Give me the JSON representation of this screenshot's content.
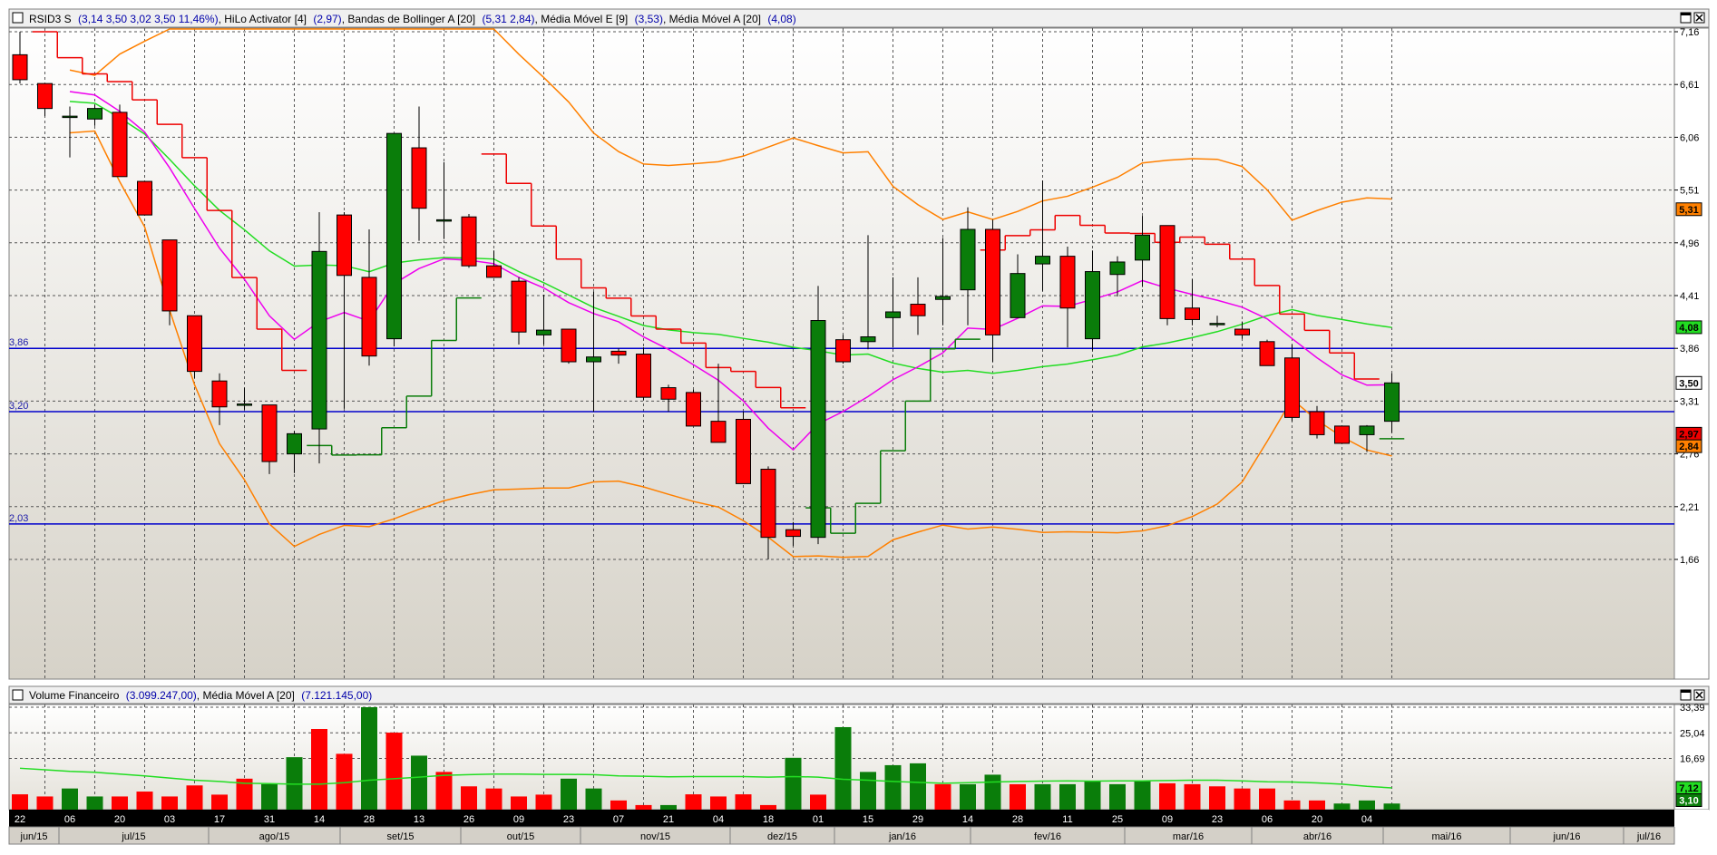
{
  "price_panel": {
    "symbol": "RSID3 S",
    "ohlc_text": "(3,14  3,50  3,02  3,50  11,46%)",
    "ind1_name": "HiLo Activator [4]",
    "ind1_value": "(2,97)",
    "ind2_name": "Bandas de Bollinger A [20]",
    "ind2_value": "(5,31  2,84)",
    "ind3_name": "Média Móvel E [9]",
    "ind3_value": "(3,53)",
    "ind4_name": "Média Móvel A [20]",
    "ind4_value": "(4,08)",
    "sep": ", "
  },
  "volume_panel": {
    "name": "Volume Financeiro",
    "value": "(3.099.247,00)",
    "ma_name": "Média Móvel A [20]",
    "ma_value": "(7.121.145,00)"
  },
  "colors": {
    "up": "#0a7d0a",
    "down": "#ff0000",
    "hilo": "#ee0000",
    "bollinger": "#ff8000",
    "ema9": "#ee00ee",
    "sma20": "#22dd22",
    "level_line": "#0000cc",
    "vol_ma": "#22dd22"
  },
  "chart_data": [
    {
      "type": "candlestick",
      "title": "RSID3 S",
      "ylim": [
        1.66,
        7.16
      ],
      "yticks": [
        "7,16",
        "6,61",
        "6,06",
        "5,51",
        "4,96",
        "4,41",
        "3,86",
        "3,31",
        "2,76",
        "2,21",
        "1,66"
      ],
      "ytick_values": [
        7.16,
        6.61,
        6.06,
        5.51,
        4.96,
        4.41,
        3.86,
        3.31,
        2.76,
        2.21,
        1.66
      ],
      "date_labels": [
        "22",
        "06",
        "20",
        "03",
        "17",
        "31",
        "14",
        "28",
        "13",
        "26",
        "09",
        "23",
        "07",
        "21",
        "04",
        "18",
        "01",
        "15",
        "29",
        "14",
        "28",
        "11",
        "25",
        "09",
        "23",
        "06",
        "20",
        "04"
      ],
      "month_labels": [
        "jun/15",
        "jul/15",
        "ago/15",
        "set/15",
        "out/15",
        "nov/15",
        "dez/15",
        "jan/16",
        "fev/16",
        "mar/16",
        "abr/16",
        "mai/16",
        "jun/16",
        "jul/16"
      ],
      "horizontal_levels": [
        {
          "label": "3,86",
          "value": 3.86
        },
        {
          "label": "3,20",
          "value": 3.2
        },
        {
          "label": "2,03",
          "value": 2.03
        }
      ],
      "last_value_tags": [
        {
          "label": "5,31",
          "value": 5.31,
          "color": "#ff8000",
          "text_color": "#000000"
        },
        {
          "label": "4,08",
          "value": 4.08,
          "color": "#22dd22",
          "text_color": "#000000"
        },
        {
          "label": "3,50",
          "value": 3.5,
          "color": "#ffffff",
          "text_color": "#000000"
        },
        {
          "label": "2,97",
          "value": 2.97,
          "color": "#ee0000",
          "text_color": "#000000"
        },
        {
          "label": "2,84",
          "value": 2.84,
          "color": "#ff8000",
          "text_color": "#000000"
        }
      ],
      "candles": [
        {
          "o": 6.92,
          "h": 7.16,
          "l": 6.62,
          "c": 6.66
        },
        {
          "o": 6.62,
          "h": 6.62,
          "l": 6.28,
          "c": 6.36
        },
        {
          "o": 6.28,
          "h": 6.38,
          "l": 5.85,
          "c": 6.28
        },
        {
          "o": 6.25,
          "h": 6.4,
          "l": 6.18,
          "c": 6.36
        },
        {
          "o": 6.32,
          "h": 6.4,
          "l": 5.65,
          "c": 5.65
        },
        {
          "o": 5.6,
          "h": 5.6,
          "l": 5.25,
          "c": 5.25
        },
        {
          "o": 4.99,
          "h": 4.99,
          "l": 4.1,
          "c": 4.25
        },
        {
          "o": 4.2,
          "h": 4.2,
          "l": 3.55,
          "c": 3.62
        },
        {
          "o": 3.52,
          "h": 3.6,
          "l": 3.06,
          "c": 3.25
        },
        {
          "o": 3.28,
          "h": 3.45,
          "l": 3.22,
          "c": 3.28
        },
        {
          "o": 3.27,
          "h": 3.27,
          "l": 2.55,
          "c": 2.68
        },
        {
          "o": 2.76,
          "h": 3.0,
          "l": 2.56,
          "c": 2.97
        },
        {
          "o": 3.02,
          "h": 5.28,
          "l": 2.66,
          "c": 4.87
        },
        {
          "o": 5.25,
          "h": 5.28,
          "l": 3.23,
          "c": 4.62
        },
        {
          "o": 4.6,
          "h": 5.1,
          "l": 3.68,
          "c": 3.78
        },
        {
          "o": 3.96,
          "h": 6.1,
          "l": 3.88,
          "c": 6.1
        },
        {
          "o": 5.95,
          "h": 6.38,
          "l": 4.98,
          "c": 5.32
        },
        {
          "o": 5.2,
          "h": 5.8,
          "l": 5.0,
          "c": 5.2
        },
        {
          "o": 5.23,
          "h": 5.26,
          "l": 4.7,
          "c": 4.72
        },
        {
          "o": 4.72,
          "h": 4.88,
          "l": 4.6,
          "c": 4.6
        },
        {
          "o": 4.56,
          "h": 4.6,
          "l": 3.9,
          "c": 4.03
        },
        {
          "o": 4.0,
          "h": 4.42,
          "l": 3.9,
          "c": 4.05
        },
        {
          "o": 4.06,
          "h": 4.06,
          "l": 3.7,
          "c": 3.72
        },
        {
          "o": 3.72,
          "h": 4.45,
          "l": 3.2,
          "c": 3.77
        },
        {
          "o": 3.83,
          "h": 3.86,
          "l": 3.7,
          "c": 3.79
        },
        {
          "o": 3.8,
          "h": 3.87,
          "l": 3.32,
          "c": 3.35
        },
        {
          "o": 3.45,
          "h": 3.48,
          "l": 3.2,
          "c": 3.33
        },
        {
          "o": 3.4,
          "h": 3.43,
          "l": 3.05,
          "c": 3.05
        },
        {
          "o": 3.1,
          "h": 3.7,
          "l": 2.88,
          "c": 2.88
        },
        {
          "o": 3.12,
          "h": 3.2,
          "l": 2.45,
          "c": 2.45
        },
        {
          "o": 2.6,
          "h": 2.63,
          "l": 1.66,
          "c": 1.89
        },
        {
          "o": 1.97,
          "h": 2.05,
          "l": 1.8,
          "c": 1.9
        },
        {
          "o": 1.89,
          "h": 4.51,
          "l": 1.82,
          "c": 4.15
        },
        {
          "o": 3.95,
          "h": 4.0,
          "l": 3.7,
          "c": 3.72
        },
        {
          "o": 3.93,
          "h": 5.04,
          "l": 3.85,
          "c": 3.98
        },
        {
          "o": 4.18,
          "h": 4.6,
          "l": 3.87,
          "c": 4.24
        },
        {
          "o": 4.32,
          "h": 4.6,
          "l": 4.0,
          "c": 4.2
        },
        {
          "o": 4.37,
          "h": 5.01,
          "l": 4.1,
          "c": 4.4
        },
        {
          "o": 4.47,
          "h": 5.33,
          "l": 4.1,
          "c": 5.1
        },
        {
          "o": 5.1,
          "h": 5.2,
          "l": 3.72,
          "c": 4.0
        },
        {
          "o": 4.18,
          "h": 4.84,
          "l": 4.18,
          "c": 4.64
        },
        {
          "o": 4.74,
          "h": 5.61,
          "l": 4.46,
          "c": 4.82
        },
        {
          "o": 4.82,
          "h": 4.92,
          "l": 3.87,
          "c": 4.28
        },
        {
          "o": 3.96,
          "h": 4.88,
          "l": 3.84,
          "c": 4.66
        },
        {
          "o": 4.63,
          "h": 4.82,
          "l": 4.4,
          "c": 4.76
        },
        {
          "o": 4.78,
          "h": 5.24,
          "l": 4.5,
          "c": 5.04
        },
        {
          "o": 5.14,
          "h": 5.14,
          "l": 4.1,
          "c": 4.17
        },
        {
          "o": 4.28,
          "h": 4.58,
          "l": 4.1,
          "c": 4.16
        },
        {
          "o": 4.12,
          "h": 4.2,
          "l": 4.08,
          "c": 4.12
        },
        {
          "o": 4.06,
          "h": 4.14,
          "l": 3.96,
          "c": 4.0
        },
        {
          "o": 3.93,
          "h": 3.95,
          "l": 3.7,
          "c": 3.68
        },
        {
          "o": 3.76,
          "h": 3.9,
          "l": 3.1,
          "c": 3.14
        },
        {
          "o": 3.2,
          "h": 3.26,
          "l": 2.92,
          "c": 2.96
        },
        {
          "o": 3.05,
          "h": 3.05,
          "l": 2.87,
          "c": 2.87
        },
        {
          "o": 2.96,
          "h": 3.06,
          "l": 2.78,
          "c": 3.05
        },
        {
          "o": 3.1,
          "h": 3.6,
          "l": 2.98,
          "c": 3.5
        }
      ]
    },
    {
      "type": "bar",
      "title": "Volume Financeiro",
      "ylim": [
        0,
        33.39
      ],
      "yticks": [
        "33,39",
        "25,04",
        "16,69"
      ],
      "ytick_values": [
        33.39,
        25.04,
        16.69
      ],
      "last_value_tags": [
        {
          "label": "7,12",
          "value": 7.12,
          "color": "#22dd22",
          "text_color": "#000000"
        },
        {
          "label": "3,10",
          "value": 3.1,
          "color": "#0a7d0a",
          "text_color": "#ffffff"
        }
      ],
      "values": [
        5,
        4.3,
        6.9,
        4.3,
        4.3,
        5.9,
        4.3,
        7.9,
        4.9,
        10.1,
        8.3,
        17.1,
        26.3,
        18.2,
        33.4,
        25.1,
        17.6,
        12.3,
        7.6,
        6.9,
        4.3,
        4.9,
        10.1,
        6.9,
        3,
        1.5,
        1.5,
        5,
        4.3,
        5,
        1.5,
        16.9,
        4.9,
        26.9,
        12.3,
        14.5,
        15.1,
        8.3,
        8.3,
        11.4,
        8.3,
        8.3,
        8.3,
        9.3,
        8.3,
        9.3,
        8.6,
        8.3,
        7.6,
        6.9,
        6.9,
        3,
        3,
        2,
        3,
        2
      ],
      "up": [
        0,
        0,
        1,
        1,
        0,
        0,
        0,
        0,
        0,
        0,
        1,
        1,
        0,
        0,
        1,
        0,
        1,
        0,
        0,
        0,
        0,
        0,
        1,
        1,
        0,
        0,
        1,
        0,
        0,
        0,
        0,
        1,
        0,
        1,
        1,
        1,
        1,
        0,
        1,
        1,
        0,
        1,
        1,
        1,
        1,
        1,
        0,
        0,
        0,
        0,
        0,
        0,
        0,
        1,
        1,
        1
      ],
      "ma": [
        13.5,
        13.0,
        12.5,
        12.2,
        11.6,
        11.0,
        10.3,
        9.6,
        9.2,
        8.6,
        8.5,
        8.3,
        8.3,
        8.8,
        9.6,
        10.1,
        10.6,
        11.2,
        11.4,
        11.6,
        11.6,
        11.5,
        11.5,
        11.4,
        11.0,
        10.9,
        10.7,
        10.8,
        10.8,
        10.8,
        10.6,
        10.8,
        10.6,
        9.9,
        9.6,
        9.2,
        8.9,
        8.6,
        8.8,
        9.0,
        9.2,
        9.3,
        9.4,
        9.3,
        9.4,
        9.4,
        9.5,
        9.6,
        9.6,
        9.4,
        9.1,
        9.0,
        8.7,
        8.3,
        7.6,
        7.1
      ]
    }
  ]
}
